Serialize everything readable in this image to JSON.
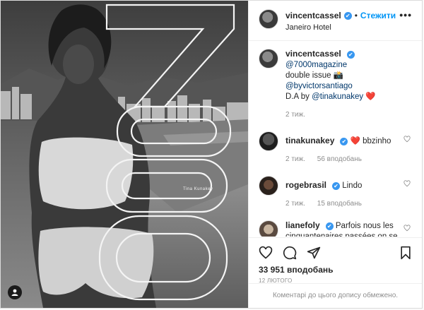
{
  "post": {
    "photo": {
      "overlay_caption": "Tina Kunakey",
      "user_tag_icon": "user-tag-icon"
    },
    "header": {
      "username": "vincentcassel",
      "verified_glyph": "✔",
      "separator": "•",
      "follow_label": "Стежити",
      "location": "Janeiro Hotel",
      "more_glyph": "•••"
    },
    "comments": [
      {
        "username": "vincentcassel",
        "verified": true,
        "text_parts": {
          "mention1": "@7000magazine",
          "line2_a": "double issue",
          "camera": "📸",
          "mention2": "@byvictorsantiago",
          "line3_a": "D.A by",
          "mention3": "@tinakunakey",
          "heart": "❤️"
        },
        "time": "2 тиж."
      },
      {
        "username": "tinakunakey",
        "verified": true,
        "heart": "❤️",
        "text": "bbzinho",
        "time": "2 тиж.",
        "likes": "56 вподобань"
      },
      {
        "username": "rogebrasil",
        "verified": true,
        "text": "Lindo",
        "time": "2 тиж.",
        "likes": "15 вподобань"
      },
      {
        "username": "lianefoly",
        "verified": true,
        "text": "Parfois nous les cinquantenaires passées on se demande pourquoi les mecs de nos âges sont tous avec des femmes plus jeunes ...réponse cette photo et ils ont bien raison ..........."
      }
    ],
    "actions": {
      "likes": "33 951 вподобань",
      "date": "12 ЛЮТОГО",
      "comments_disabled": "Коментарі до цього допису обмежено."
    },
    "colors": {
      "accent": "#0095f6",
      "verified": "#3897f0",
      "heart": "#ed4956",
      "meta": "#8e8e8e"
    }
  }
}
